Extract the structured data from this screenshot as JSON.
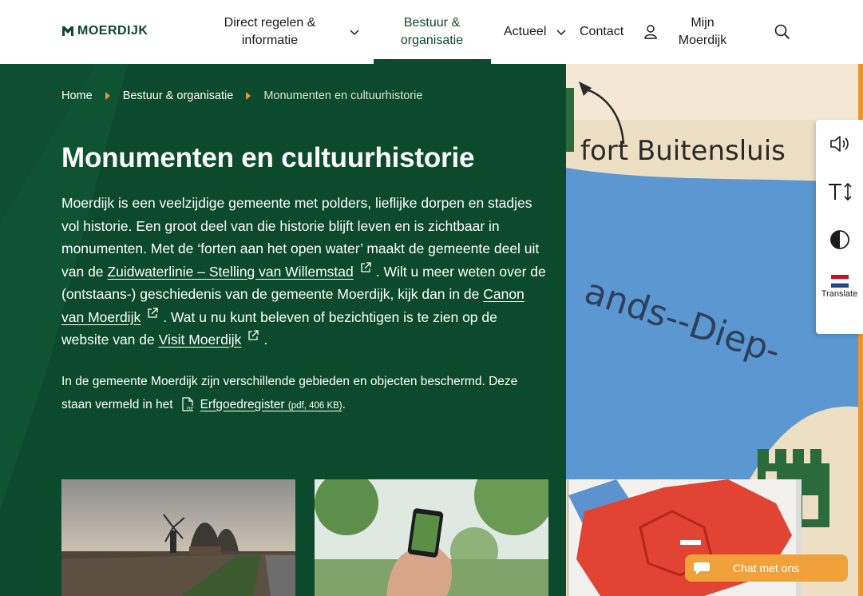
{
  "header": {
    "logo_text": "MOERDIJK",
    "nav": {
      "direct_line1": "Direct regelen &",
      "direct_line2": "informatie",
      "bestuur_line1": "Bestuur &",
      "bestuur_line2": "organisatie",
      "actueel": "Actueel",
      "contact": "Contact",
      "mijn_line1": "Mijn",
      "mijn_line2": "Moerdijk"
    }
  },
  "breadcrumb": {
    "home": "Home",
    "bestuur": "Bestuur & organisatie",
    "current": "Monumenten en cultuurhistorie"
  },
  "page": {
    "title": "Monumenten en cultuurhistorie",
    "intro_part1": "Moerdijk is een veelzijdige gemeente met polders, lieflijke dorpen en stadjes vol historie. Een groot deel van die historie blijft leven en is zichtbaar in monumenten. Met de ‘forten aan het open water’ maakt de gemeente deel uit van de ",
    "link_zuidwaterlinie": "Zuidwaterlinie – Stelling van Willemstad",
    "intro_part2": ". Wilt u meer weten over de (ontstaans-) geschiedenis van de gemeente Moerdijk, kijk dan in de ",
    "link_canon": "Canon van Moerdijk",
    "intro_part3": ". Wat u nu kunt beleven of bezichtigen is te zien op de website van de ",
    "link_visit": "Visit Moerdijk",
    "intro_part4": ".",
    "para2_part1": "In de gemeente Moerdijk zijn verschillende gebieden en objecten beschermd. Deze staan vermeld in het",
    "link_erfgoed": "Erfgoedregister",
    "erfgoed_meta": "(pdf, 406 KB)",
    "para2_end": "."
  },
  "map": {
    "label_fort": "fort Buitensluis",
    "label_diep": "ands--Diep-"
  },
  "tools": {
    "translate_label": "Translate"
  },
  "chat": {
    "label": "Chat met ons"
  },
  "colors": {
    "brand_green": "#0b4a2c",
    "accent_orange": "#e8952f"
  }
}
